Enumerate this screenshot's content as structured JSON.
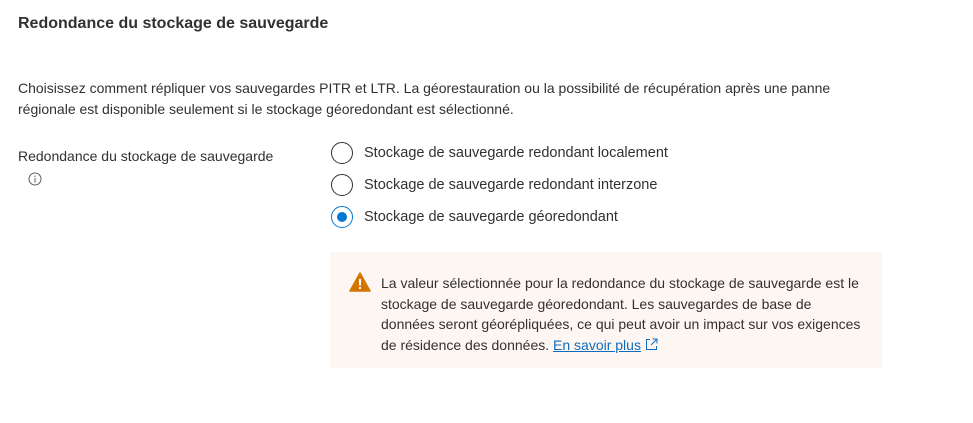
{
  "section": {
    "title": "Redondance du stockage de sauvegarde",
    "description": "Choisissez comment répliquer vos sauvegardes PITR et LTR. La géorestauration ou la possibilité de récupération après une panne régionale est disponible seulement si le stockage géoredondant est sélectionné."
  },
  "field": {
    "label": "Redondance du stockage de sauvegarde",
    "info_icon": "info-icon",
    "options": [
      {
        "label": "Stockage de sauvegarde redondant localement",
        "selected": false
      },
      {
        "label": "Stockage de sauvegarde redondant interzone",
        "selected": false
      },
      {
        "label": "Stockage de sauvegarde géoredondant",
        "selected": true
      }
    ]
  },
  "warning": {
    "icon": "warning-icon",
    "text": "La valeur sélectionnée pour la redondance du stockage de sauvegarde est le stockage de sauvegarde géoredondant. Les sauvegardes de base de données seront géorépliquées, ce qui peut avoir un impact sur vos exigences de résidence des données.",
    "link_label": "En savoir plus",
    "link_icon": "external-link-icon"
  },
  "colors": {
    "accent": "#0078d4",
    "warning_icon": "#d47500",
    "warning_background": "#fdf6f3",
    "link": "#0f6cbd",
    "text": "#323130"
  }
}
